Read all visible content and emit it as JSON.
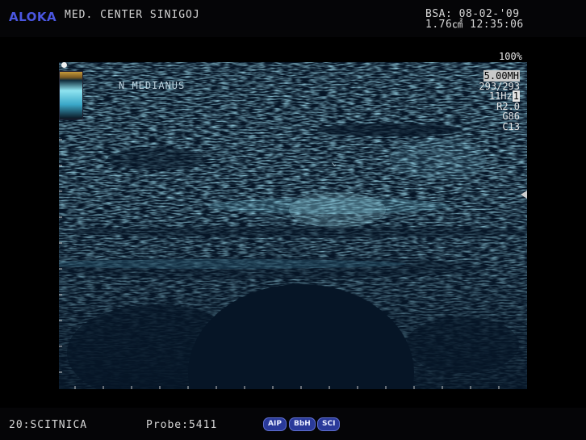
{
  "header": {
    "logo": "ALOKA",
    "site": "MED. CENTER SINIGOJ",
    "bsa_line": "BSA: 08-02-'09",
    "info_line": "1.76㎠ 12:35:06",
    "gain_percent": "100%"
  },
  "image": {
    "annotation": "N MEDIANUS",
    "params": {
      "frequency": "5.00MH",
      "lines": "293/293",
      "frame_rate": "11Hz",
      "frame_rate_box": "1",
      "r": "R2.0",
      "gain": "G86",
      "contrast": "C13"
    }
  },
  "footer": {
    "preset": "20:SCITNICA",
    "probe": "Probe:5411",
    "badges": [
      "AIP",
      "BbH",
      "SCI"
    ]
  },
  "colors": {
    "logo": "#4a56e0",
    "badge": "#2a3a9a",
    "tissue": "#5fb6d6"
  }
}
